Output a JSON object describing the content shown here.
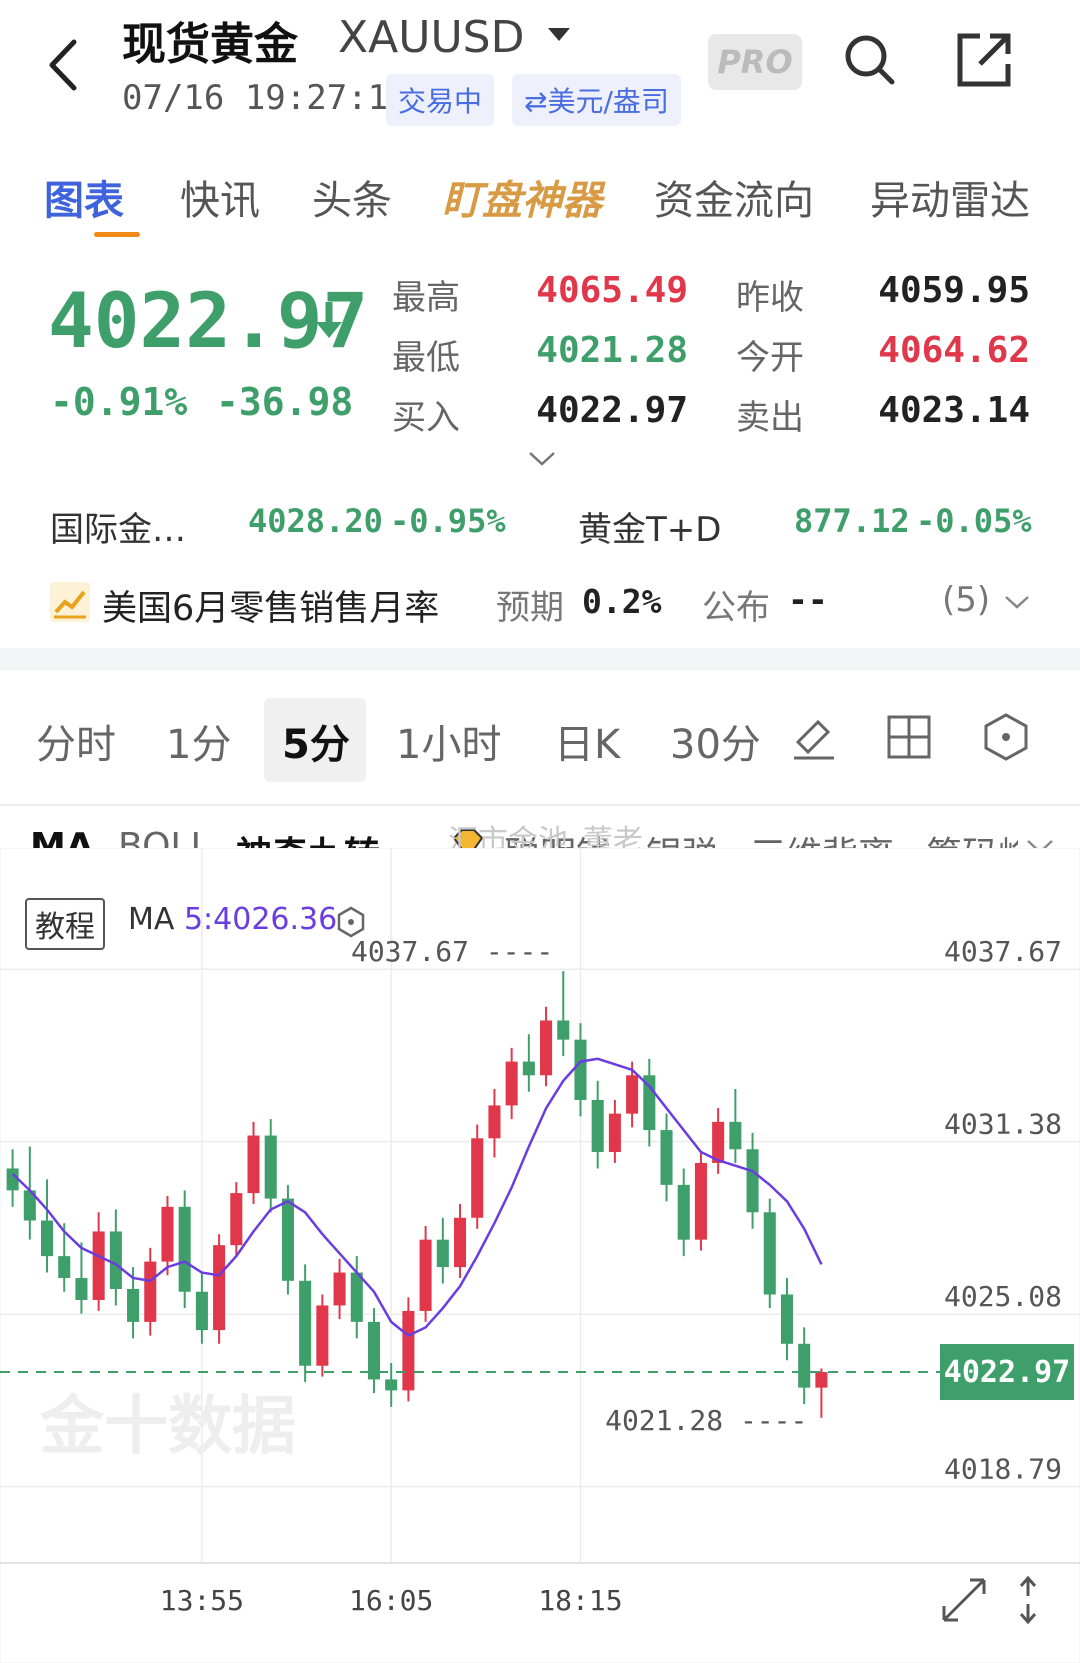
{
  "header": {
    "title": "现货黄金",
    "symbol": "XAUUSD",
    "datetime": "07/16 19:27:18",
    "status": "交易中",
    "currency": "⇄美元/盎司",
    "pro_label": "PRO"
  },
  "tabs": [
    "图表",
    "快讯",
    "头条",
    "盯盘神器",
    "资金流向",
    "异动雷达"
  ],
  "quote": {
    "price": "4022.97",
    "pct": "-0.91%",
    "change": "-36.98",
    "high_label": "最高",
    "high": "4065.49",
    "low_label": "最低",
    "low": "4021.28",
    "bid_label": "买入",
    "bid": "4022.97",
    "prev_close_label": "昨收",
    "prev_close": "4059.95",
    "open_label": "今开",
    "open": "4064.62",
    "ask_label": "卖出",
    "ask": "4023.14"
  },
  "related": {
    "intl_name": "国际金…",
    "intl_price": "4028.20",
    "intl_pct": "-0.95%",
    "td_name": "黄金T+D",
    "td_price": "877.12",
    "td_pct": "-0.05%"
  },
  "event": {
    "title": "美国6月零售销售月率",
    "expected_label": "预期",
    "expected": "0.2%",
    "published_label": "公布",
    "published": "--",
    "count": "(5)"
  },
  "periods": [
    "分时",
    "1分",
    "5分",
    "1小时",
    "日K",
    "30分"
  ],
  "indicators": [
    "MA",
    "BOLL",
    "神奇九转",
    "聪明钱",
    "银弹",
    "三维背离",
    "筹码峰"
  ],
  "watermark": "汇市金池_董老",
  "brand_watermark": "金十数据",
  "legend": {
    "tutorial": "教程",
    "ma_name": "MA",
    "ma_value": "5:4026.36"
  },
  "colors": {
    "up": "#e0384a",
    "down": "#3f9f6b",
    "ma": "#6b3de0",
    "accent": "#3e63dd",
    "tab_underline": "#f28a18"
  },
  "chart_data": {
    "type": "candlestick",
    "price_ticks": [
      "4037.67",
      "4031.38",
      "4025.08",
      "4018.79"
    ],
    "time_ticks": [
      "13:55",
      "16:05",
      "18:15"
    ],
    "ylim": [
      4016,
      4041
    ],
    "current_price": "4022.97",
    "max_label": "4037.67",
    "min_label": "4021.28",
    "ma_label": "MA5",
    "candles": [
      [
        4030.4,
        4031.1,
        4029.0,
        4029.6
      ],
      [
        4029.6,
        4031.2,
        4027.8,
        4028.5
      ],
      [
        4028.5,
        4030.0,
        4026.6,
        4027.2
      ],
      [
        4027.2,
        4028.4,
        4025.9,
        4026.4
      ],
      [
        4026.4,
        4027.7,
        4025.1,
        4025.6
      ],
      [
        4025.6,
        4028.8,
        4025.2,
        4028.1
      ],
      [
        4028.1,
        4028.9,
        4025.4,
        4026.0
      ],
      [
        4026.0,
        4026.8,
        4024.2,
        4024.8
      ],
      [
        4024.8,
        4027.5,
        4024.3,
        4027.0
      ],
      [
        4027.0,
        4029.4,
        4026.5,
        4029.0
      ],
      [
        4029.0,
        4029.6,
        4025.3,
        4025.9
      ],
      [
        4025.9,
        4026.6,
        4024.0,
        4024.5
      ],
      [
        4024.5,
        4028.0,
        4024.0,
        4027.6
      ],
      [
        4027.6,
        4029.9,
        4027.2,
        4029.5
      ],
      [
        4029.5,
        4032.1,
        4029.1,
        4031.6
      ],
      [
        4031.6,
        4032.2,
        4028.8,
        4029.3
      ],
      [
        4029.3,
        4029.8,
        4025.8,
        4026.3
      ],
      [
        4026.3,
        4026.9,
        4022.6,
        4023.2
      ],
      [
        4023.2,
        4025.8,
        4022.8,
        4025.4
      ],
      [
        4025.4,
        4027.1,
        4024.9,
        4026.6
      ],
      [
        4026.6,
        4027.2,
        4024.2,
        4024.8
      ],
      [
        4024.8,
        4025.3,
        4022.2,
        4022.7
      ],
      [
        4022.7,
        4023.3,
        4021.7,
        4022.3
      ],
      [
        4022.3,
        4025.7,
        4021.9,
        4025.2
      ],
      [
        4025.2,
        4028.3,
        4024.8,
        4027.8
      ],
      [
        4027.8,
        4028.6,
        4026.2,
        4026.8
      ],
      [
        4026.8,
        4029.1,
        4026.4,
        4028.6
      ],
      [
        4028.6,
        4032.0,
        4028.2,
        4031.5
      ],
      [
        4031.5,
        4033.3,
        4030.8,
        4032.7
      ],
      [
        4032.7,
        4034.8,
        4032.2,
        4034.3
      ],
      [
        4034.3,
        4035.3,
        4033.2,
        4033.8
      ],
      [
        4033.8,
        4036.3,
        4033.4,
        4035.8
      ],
      [
        4035.8,
        4037.6,
        4034.5,
        4035.1
      ],
      [
        4035.1,
        4035.7,
        4032.3,
        4032.9
      ],
      [
        4032.9,
        4033.6,
        4030.4,
        4031.0
      ],
      [
        4031.0,
        4032.9,
        4030.6,
        4032.4
      ],
      [
        4032.4,
        4034.3,
        4031.9,
        4033.8
      ],
      [
        4033.8,
        4034.4,
        4031.2,
        4031.8
      ],
      [
        4031.8,
        4032.4,
        4029.2,
        4029.8
      ],
      [
        4029.8,
        4030.4,
        4027.2,
        4027.8
      ],
      [
        4027.8,
        4031.0,
        4027.4,
        4030.6
      ],
      [
        4030.6,
        4032.6,
        4030.2,
        4032.1
      ],
      [
        4032.1,
        4033.3,
        4030.6,
        4031.1
      ],
      [
        4031.1,
        4031.7,
        4028.2,
        4028.8
      ],
      [
        4028.8,
        4029.3,
        4025.3,
        4025.8
      ],
      [
        4025.8,
        4026.4,
        4023.4,
        4024.0
      ],
      [
        4024.0,
        4024.6,
        4021.8,
        4022.4
      ],
      [
        4022.4,
        4023.1,
        4021.3,
        4022.97
      ]
    ],
    "ma5": [
      4030.2,
      4029.6,
      4028.9,
      4028.1,
      4027.5,
      4027.2,
      4026.9,
      4026.4,
      4026.3,
      4026.8,
      4027.0,
      4026.6,
      4026.5,
      4027.2,
      4028.1,
      4028.9,
      4029.2,
      4028.8,
      4028.0,
      4027.3,
      4026.6,
      4025.9,
      4024.8,
      4024.3,
      4024.6,
      4025.3,
      4026.1,
      4027.2,
      4028.4,
      4029.7,
      4031.2,
      4032.6,
      4033.6,
      4034.3,
      4034.4,
      4034.2,
      4034.0,
      4033.4,
      4032.6,
      4031.8,
      4031.0,
      4030.7,
      4030.5,
      4030.3,
      4029.8,
      4029.2,
      4028.2,
      4026.9
    ]
  }
}
